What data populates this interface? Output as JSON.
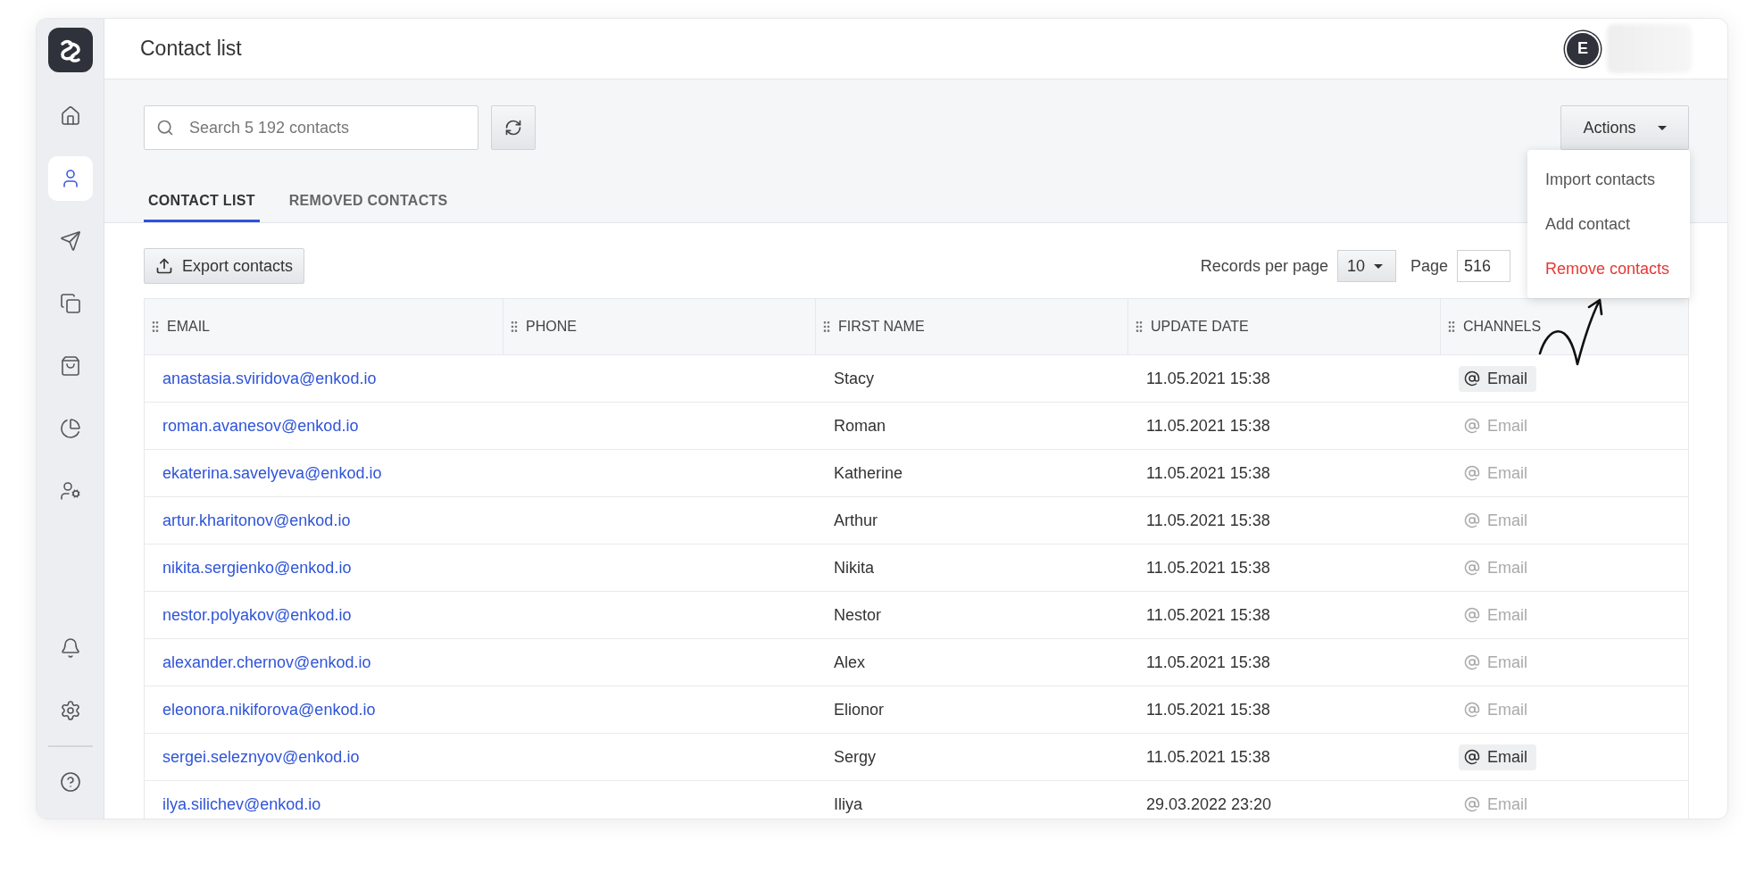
{
  "header": {
    "title": "Contact list",
    "avatar_letter": "E"
  },
  "sidebar": {
    "items": [
      {
        "selected": false
      },
      {
        "selected": true
      },
      {
        "selected": false
      },
      {
        "selected": false
      },
      {
        "selected": false
      },
      {
        "selected": false
      },
      {
        "selected": false
      }
    ]
  },
  "search": {
    "placeholder": "Search 5 192 contacts"
  },
  "actions": {
    "label": "Actions",
    "menu": [
      {
        "label": "Import contacts",
        "danger": false
      },
      {
        "label": "Add contact",
        "danger": false
      },
      {
        "label": "Remove contacts",
        "danger": true
      }
    ]
  },
  "tabs": [
    {
      "label": "CONTACT LIST",
      "selected": true
    },
    {
      "label": "REMOVED CONTACTS",
      "selected": false
    }
  ],
  "export_button": "Export contacts",
  "pagination": {
    "records_label": "Records per page",
    "records_value": "10",
    "page_label": "Page",
    "page_value": "516"
  },
  "table": {
    "columns": [
      "EMAIL",
      "PHONE",
      "FIRST NAME",
      "UPDATE DATE",
      "CHANNELS"
    ],
    "rows": [
      {
        "email": "anastasia.sviridova@enkod.io",
        "first_name": "Stacy",
        "update_date": "11.05.2021 15:38",
        "channel": "Email",
        "channel_active": true
      },
      {
        "email": "roman.avanesov@enkod.io",
        "first_name": "Roman",
        "update_date": "11.05.2021 15:38",
        "channel": "Email",
        "channel_active": false
      },
      {
        "email": "ekaterina.savelyeva@enkod.io",
        "first_name": "Katherine",
        "update_date": "11.05.2021 15:38",
        "channel": "Email",
        "channel_active": false
      },
      {
        "email": "artur.kharitonov@enkod.io",
        "first_name": "Arthur",
        "update_date": "11.05.2021 15:38",
        "channel": "Email",
        "channel_active": false
      },
      {
        "email": "nikita.sergienko@enkod.io",
        "first_name": "Nikita",
        "update_date": "11.05.2021 15:38",
        "channel": "Email",
        "channel_active": false
      },
      {
        "email": "nestor.polyakov@enkod.io",
        "first_name": "Nestor",
        "update_date": "11.05.2021 15:38",
        "channel": "Email",
        "channel_active": false
      },
      {
        "email": "alexander.chernov@enkod.io",
        "first_name": "Alex",
        "update_date": "11.05.2021 15:38",
        "channel": "Email",
        "channel_active": false
      },
      {
        "email": "eleonora.nikiforova@enkod.io",
        "first_name": "Elionor",
        "update_date": "11.05.2021 15:38",
        "channel": "Email",
        "channel_active": false
      },
      {
        "email": "sergei.seleznyov@enkod.io",
        "first_name": "Sergy",
        "update_date": "11.05.2021 15:38",
        "channel": "Email",
        "channel_active": true
      },
      {
        "email": "ilya.silichev@enkod.io",
        "first_name": "Iliya",
        "update_date": "29.03.2022 23:20",
        "channel": "Email",
        "channel_active": false
      }
    ]
  }
}
